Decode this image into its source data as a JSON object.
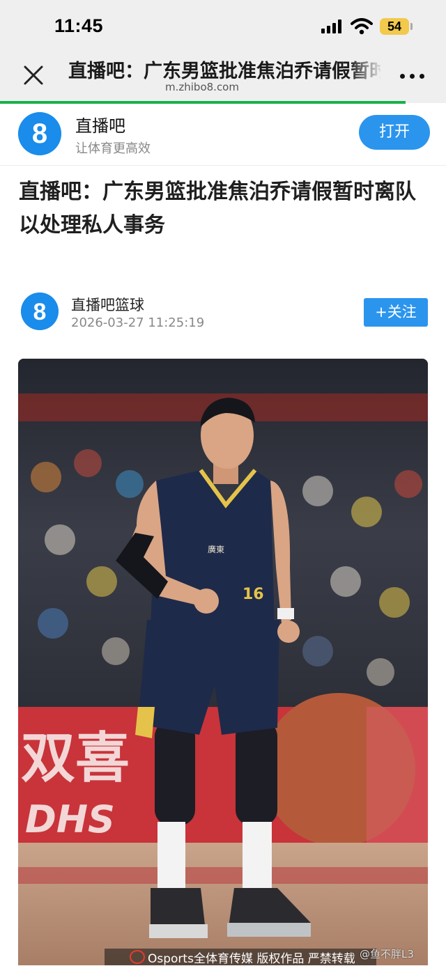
{
  "status_bar": {
    "time": "11:45",
    "battery": "54",
    "battery_color": "#f2c94c",
    "icons": [
      "signal-icon",
      "wifi-icon",
      "battery-icon"
    ]
  },
  "browser": {
    "title": "直播吧：广东男篮批准焦泊乔请假暂时离队以处理私人事务",
    "url": "m.zhibo8.com",
    "progress_fraction": 0.91,
    "progress_color": "#16b24b",
    "icons": [
      "close-icon",
      "more-icon"
    ]
  },
  "app_banner": {
    "logo_text": "8",
    "name": "直播吧",
    "slogan": "让体育更高效",
    "open_label": "打开",
    "accent_color": "#2b95ee"
  },
  "article": {
    "title": "直播吧：广东男篮批准焦泊乔请假暂时离队以处理私人事务",
    "author": {
      "logo_text": "8",
      "name": "直播吧篮球",
      "time": "2026-03-27 11:25:19",
      "follow_label": "+关注"
    },
    "image": {
      "jersey_team": "廣東",
      "jersey_number": "16",
      "ad_board_text": "双喜",
      "ad_board_sub": "DHS",
      "caption": "Osports全体育传媒  版权作品 严禁转载",
      "watermark": "@鱼不胖L3"
    }
  }
}
